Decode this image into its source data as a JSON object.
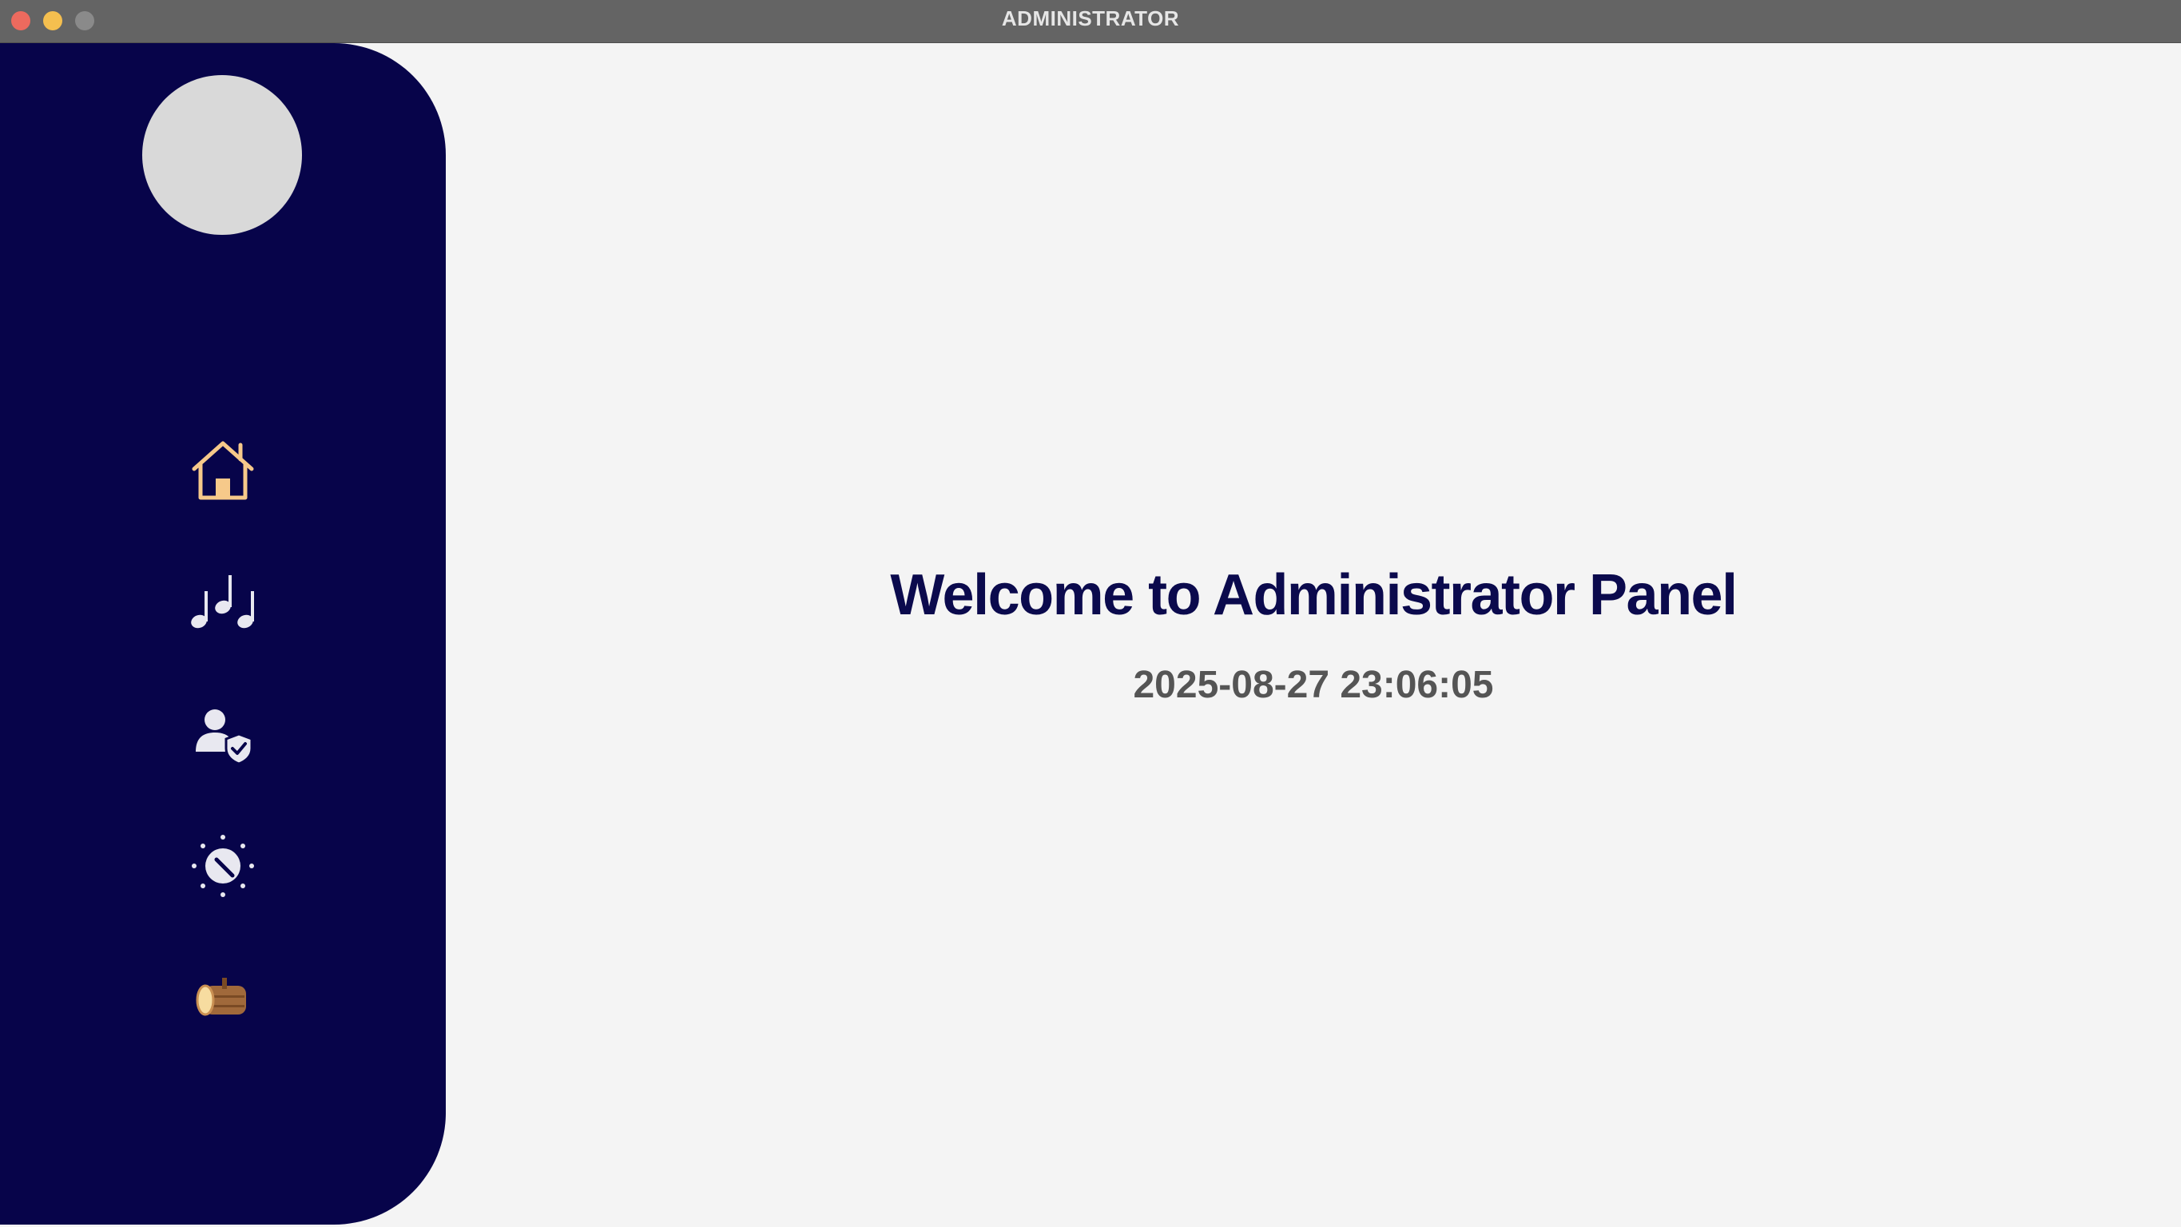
{
  "window": {
    "title": "ADMINISTRATOR"
  },
  "sidebar": {
    "avatar": "avatar-placeholder",
    "items": [
      {
        "icon": "home-icon",
        "active": true,
        "color": "#f6c98a"
      },
      {
        "icon": "music-notes-icon",
        "active": false,
        "color": "#e8e8f0"
      },
      {
        "icon": "user-shield-icon",
        "active": false,
        "color": "#e8e8f0"
      },
      {
        "icon": "dial-icon",
        "active": false,
        "color": "#e8e8f0"
      },
      {
        "icon": "log-icon",
        "active": false,
        "color": "#a0693b"
      }
    ]
  },
  "main": {
    "welcome": "Welcome to Administrator Panel",
    "datetime": "2025-08-27 23:06:05"
  },
  "colors": {
    "sidebar": "#07044a",
    "accent": "#f6c98a",
    "heading": "#0b0a4d",
    "background": "#f4f4f4"
  }
}
